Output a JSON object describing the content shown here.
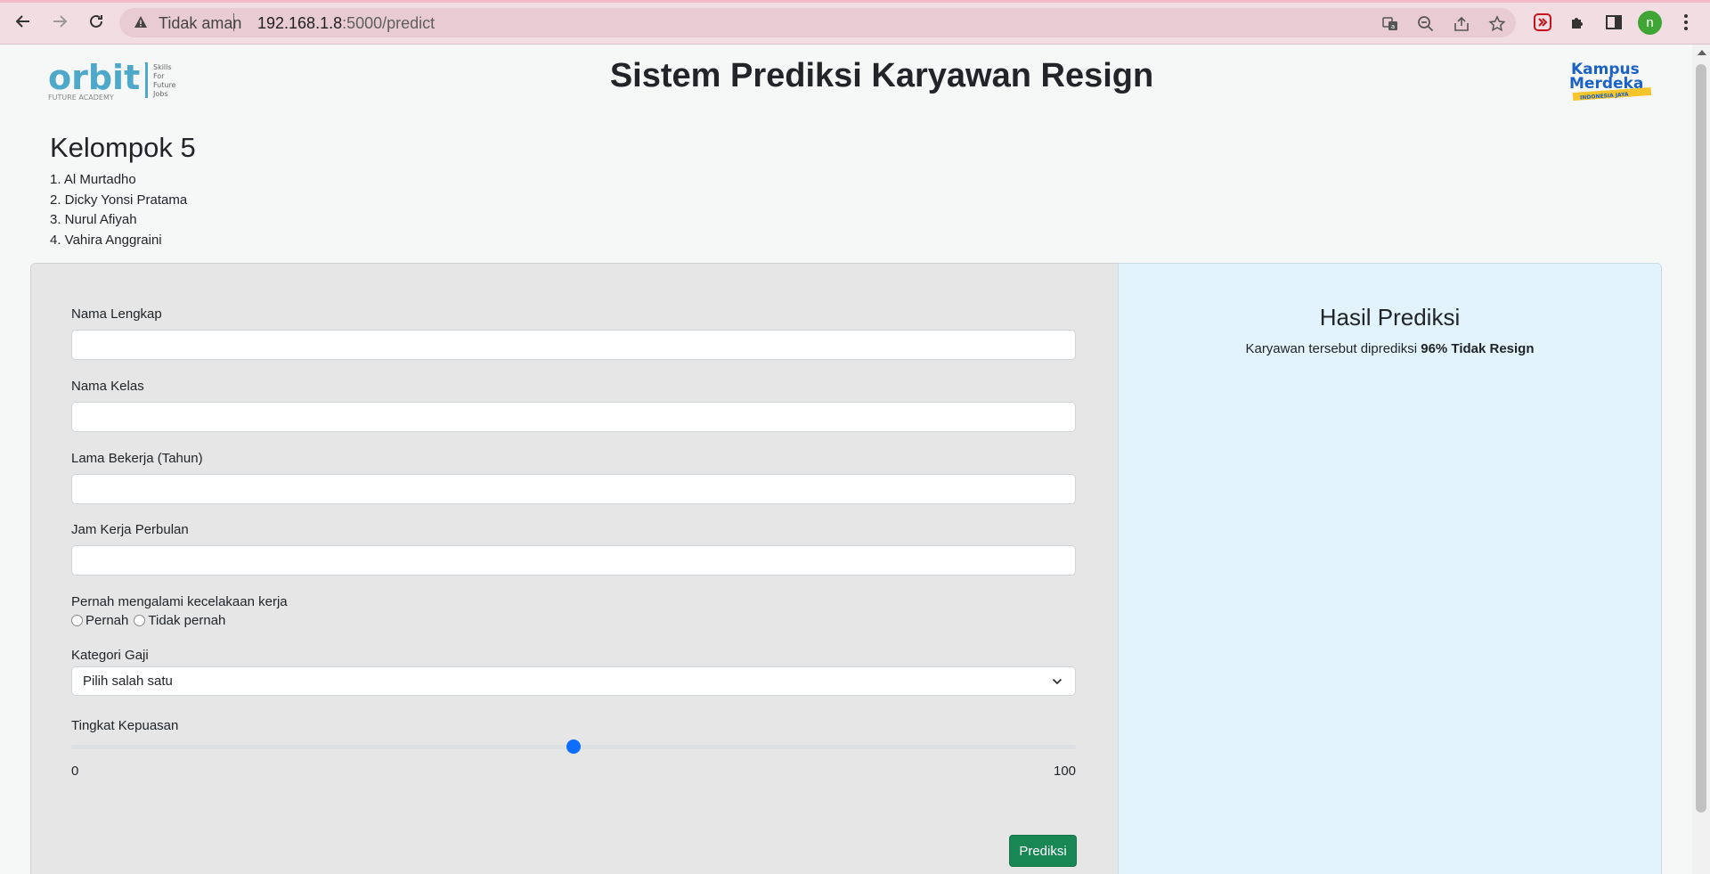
{
  "browser": {
    "security_label": "Tidak aman",
    "url_host": "192.168.1.8",
    "url_path": ":5000/predict",
    "profile_initial": "n"
  },
  "header": {
    "title": "Sistem Prediksi Karyawan Resign",
    "orbit_logo_text": "orbit",
    "orbit_tagline": [
      "Skills",
      "For",
      "Future",
      "Jobs"
    ],
    "orbit_subtitle": "FUTURE ACADEMY",
    "kampus_logo_line1": "Kampus",
    "kampus_logo_line2": "Merdeka",
    "kampus_logo_ribbon": "INDONESIA JAYA"
  },
  "team": {
    "title": "Kelompok 5",
    "members": [
      "1. Al Murtadho",
      "2. Dicky Yonsi Pratama",
      "3. Nurul Afiyah",
      "4. Vahira Anggraini"
    ]
  },
  "form": {
    "nama_label": "Nama Lengkap",
    "nama_value": "",
    "kelas_label": "Nama Kelas",
    "kelas_value": "",
    "lama_label": "Lama Bekerja (Tahun)",
    "lama_value": "",
    "jam_label": "Jam Kerja Perbulan",
    "jam_value": "",
    "kecelakaan_label": "Pernah mengalami kecelakaan kerja",
    "kecelakaan_options": [
      "Pernah",
      "Tidak pernah"
    ],
    "gaji_label": "Kategori Gaji",
    "gaji_selected": "Pilih salah satu",
    "kepuasan_label": "Tingkat Kepuasan",
    "kepuasan_min": "0",
    "kepuasan_max": "100",
    "kepuasan_value": 50,
    "submit_label": "Prediksi"
  },
  "result": {
    "title": "Hasil Prediksi",
    "text_prefix": "Karyawan tersebut diprediksi ",
    "text_value": "96% Tidak Resign"
  },
  "colors": {
    "accent": "#0d6efd",
    "submit": "#198754",
    "form_bg": "#e6e6e6",
    "result_bg": "#e2f3fb"
  }
}
